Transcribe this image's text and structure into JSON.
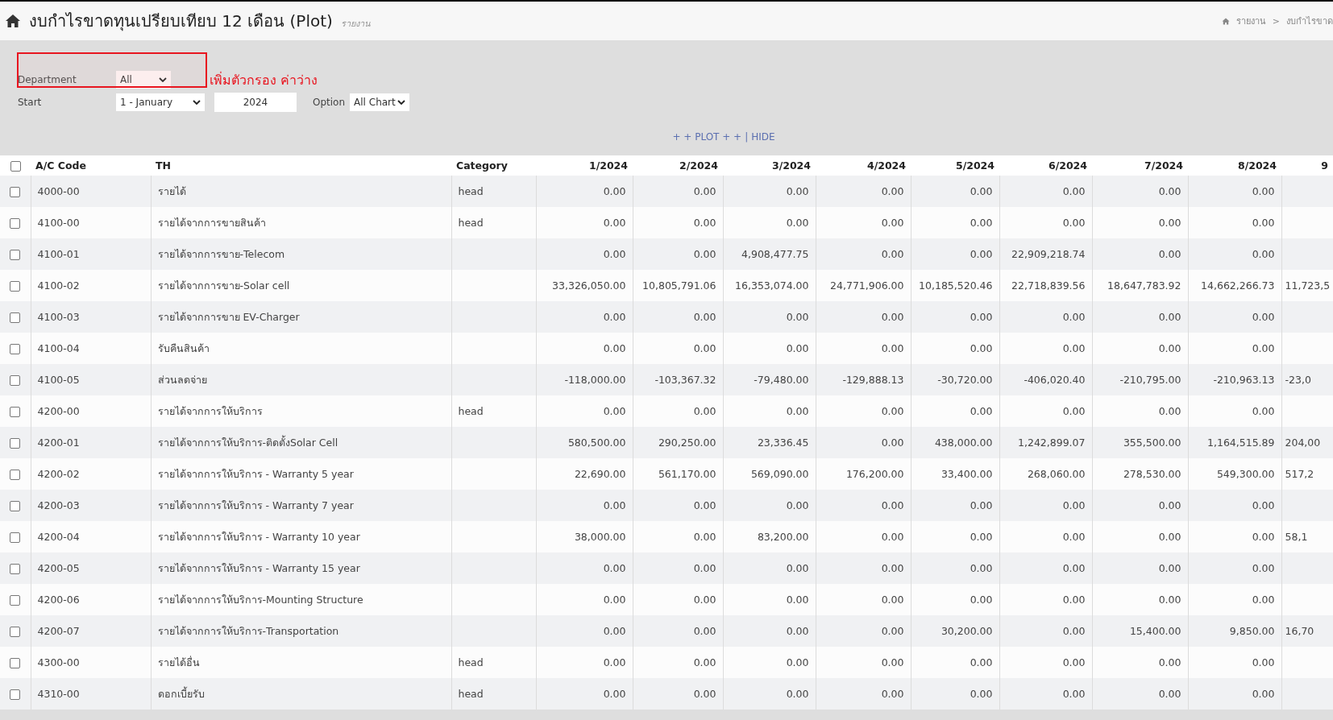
{
  "header": {
    "title": "งบกำไรขาดทุนเปรียบเทียบ 12 เดือน (Plot)",
    "subtitle": "รายงาน",
    "breadcrumb": [
      "รายงาน",
      ">",
      "งบกำไรขาด"
    ]
  },
  "filters": {
    "department": {
      "label": "Department",
      "value": "All"
    },
    "annotation": "เพิ่มตัวกรอง ค่าว่าง",
    "start": {
      "label": "Start",
      "month": "1 - January",
      "year": "2024"
    },
    "option": {
      "label": "Option",
      "value": "All Chart"
    }
  },
  "plot_links": {
    "plot": "+ + PLOT + +",
    "separator": "|",
    "hide": "HIDE"
  },
  "table": {
    "select_all_checked": false,
    "columns": [
      "A/C Code",
      "TH",
      "Category",
      "1/2024",
      "2/2024",
      "3/2024",
      "4/2024",
      "5/2024",
      "6/2024",
      "7/2024",
      "8/2024",
      "9"
    ],
    "rows": [
      {
        "checked": false,
        "cells": [
          "4000-00",
          "รายได้",
          "head",
          "0.00",
          "0.00",
          "0.00",
          "0.00",
          "0.00",
          "0.00",
          "0.00",
          "0.00",
          ""
        ]
      },
      {
        "checked": false,
        "cells": [
          "4100-00",
          "รายได้จากการขายสินค้า",
          "head",
          "0.00",
          "0.00",
          "0.00",
          "0.00",
          "0.00",
          "0.00",
          "0.00",
          "0.00",
          ""
        ]
      },
      {
        "checked": false,
        "cells": [
          "4100-01",
          "รายได้จากการขาย-Telecom",
          "",
          "0.00",
          "0.00",
          "4,908,477.75",
          "0.00",
          "0.00",
          "22,909,218.74",
          "0.00",
          "0.00",
          ""
        ]
      },
      {
        "checked": false,
        "cells": [
          "4100-02",
          "รายได้จากการขาย-Solar cell",
          "",
          "33,326,050.00",
          "10,805,791.06",
          "16,353,074.00",
          "24,771,906.00",
          "10,185,520.46",
          "22,718,839.56",
          "18,647,783.92",
          "14,662,266.73",
          "11,723,5"
        ]
      },
      {
        "checked": false,
        "cells": [
          "4100-03",
          "รายได้จากการขาย EV-Charger",
          "",
          "0.00",
          "0.00",
          "0.00",
          "0.00",
          "0.00",
          "0.00",
          "0.00",
          "0.00",
          ""
        ]
      },
      {
        "checked": false,
        "cells": [
          "4100-04",
          "รับคืนสินค้า",
          "",
          "0.00",
          "0.00",
          "0.00",
          "0.00",
          "0.00",
          "0.00",
          "0.00",
          "0.00",
          ""
        ]
      },
      {
        "checked": false,
        "cells": [
          "4100-05",
          "ส่วนลดจ่าย",
          "",
          "-118,000.00",
          "-103,367.32",
          "-79,480.00",
          "-129,888.13",
          "-30,720.00",
          "-406,020.40",
          "-210,795.00",
          "-210,963.13",
          "-23,0"
        ]
      },
      {
        "checked": false,
        "cells": [
          "4200-00",
          "รายได้จากการให้บริการ",
          "head",
          "0.00",
          "0.00",
          "0.00",
          "0.00",
          "0.00",
          "0.00",
          "0.00",
          "0.00",
          ""
        ]
      },
      {
        "checked": false,
        "cells": [
          "4200-01",
          "รายได้จากการให้บริการ-ติดตั้งSolar Cell",
          "",
          "580,500.00",
          "290,250.00",
          "23,336.45",
          "0.00",
          "438,000.00",
          "1,242,899.07",
          "355,500.00",
          "1,164,515.89",
          "204,00"
        ]
      },
      {
        "checked": false,
        "cells": [
          "4200-02",
          "รายได้จากการให้บริการ - Warranty 5 year",
          "",
          "22,690.00",
          "561,170.00",
          "569,090.00",
          "176,200.00",
          "33,400.00",
          "268,060.00",
          "278,530.00",
          "549,300.00",
          "517,2"
        ]
      },
      {
        "checked": false,
        "cells": [
          "4200-03",
          "รายได้จากการให้บริการ - Warranty 7 year",
          "",
          "0.00",
          "0.00",
          "0.00",
          "0.00",
          "0.00",
          "0.00",
          "0.00",
          "0.00",
          ""
        ]
      },
      {
        "checked": false,
        "cells": [
          "4200-04",
          "รายได้จากการให้บริการ - Warranty 10 year",
          "",
          "38,000.00",
          "0.00",
          "83,200.00",
          "0.00",
          "0.00",
          "0.00",
          "0.00",
          "0.00",
          "58,1"
        ]
      },
      {
        "checked": false,
        "cells": [
          "4200-05",
          "รายได้จากการให้บริการ - Warranty 15 year",
          "",
          "0.00",
          "0.00",
          "0.00",
          "0.00",
          "0.00",
          "0.00",
          "0.00",
          "0.00",
          ""
        ]
      },
      {
        "checked": false,
        "cells": [
          "4200-06",
          "รายได้จากการให้บริการ-Mounting Structure",
          "",
          "0.00",
          "0.00",
          "0.00",
          "0.00",
          "0.00",
          "0.00",
          "0.00",
          "0.00",
          ""
        ]
      },
      {
        "checked": false,
        "cells": [
          "4200-07",
          "รายได้จากการให้บริการ-Transportation",
          "",
          "0.00",
          "0.00",
          "0.00",
          "0.00",
          "30,200.00",
          "0.00",
          "15,400.00",
          "9,850.00",
          "16,70"
        ]
      },
      {
        "checked": false,
        "cells": [
          "4300-00",
          "รายได้อื่น",
          "head",
          "0.00",
          "0.00",
          "0.00",
          "0.00",
          "0.00",
          "0.00",
          "0.00",
          "0.00",
          ""
        ]
      },
      {
        "checked": false,
        "cells": [
          "4310-00",
          "ดอกเบี้ยรับ",
          "head",
          "0.00",
          "0.00",
          "0.00",
          "0.00",
          "0.00",
          "0.00",
          "0.00",
          "0.00",
          ""
        ]
      }
    ]
  }
}
